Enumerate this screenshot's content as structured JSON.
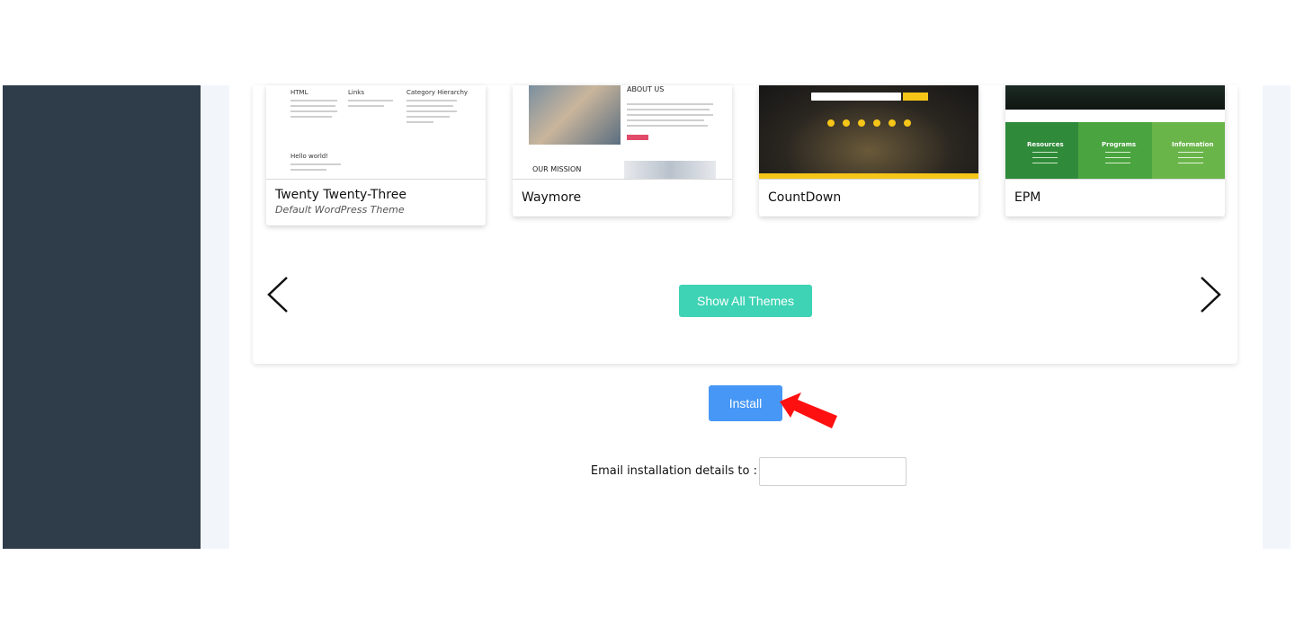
{
  "themes": [
    {
      "name": "Twenty Twenty-Three",
      "subtitle": "Default WordPress Theme",
      "preview": {
        "col1": "HTML",
        "col2": "Links",
        "col3": "Category Hierarchy",
        "post": "Hello world!"
      }
    },
    {
      "name": "Waymore",
      "preview": {
        "heading": "ABOUT US",
        "section": "OUR MISSION"
      }
    },
    {
      "name": "CountDown",
      "preview": {
        "accent": "#f5c518"
      }
    },
    {
      "name": "EPM",
      "preview": {
        "col1": "Resources",
        "col2": "Programs",
        "col3": "Information"
      }
    }
  ],
  "carousel": {
    "prev_icon": "chevron-left-icon",
    "next_icon": "chevron-right-icon",
    "show_all_label": "Show All Themes"
  },
  "install": {
    "label": "Install",
    "pointer_icon": "red-arrow-icon"
  },
  "email": {
    "label": "Email installation details to :",
    "value": "",
    "placeholder": ""
  },
  "colors": {
    "sidebar": "#2f3c4a",
    "show_all": "#3ed3b5",
    "install": "#4697f6",
    "pointer": "#ff0000"
  }
}
